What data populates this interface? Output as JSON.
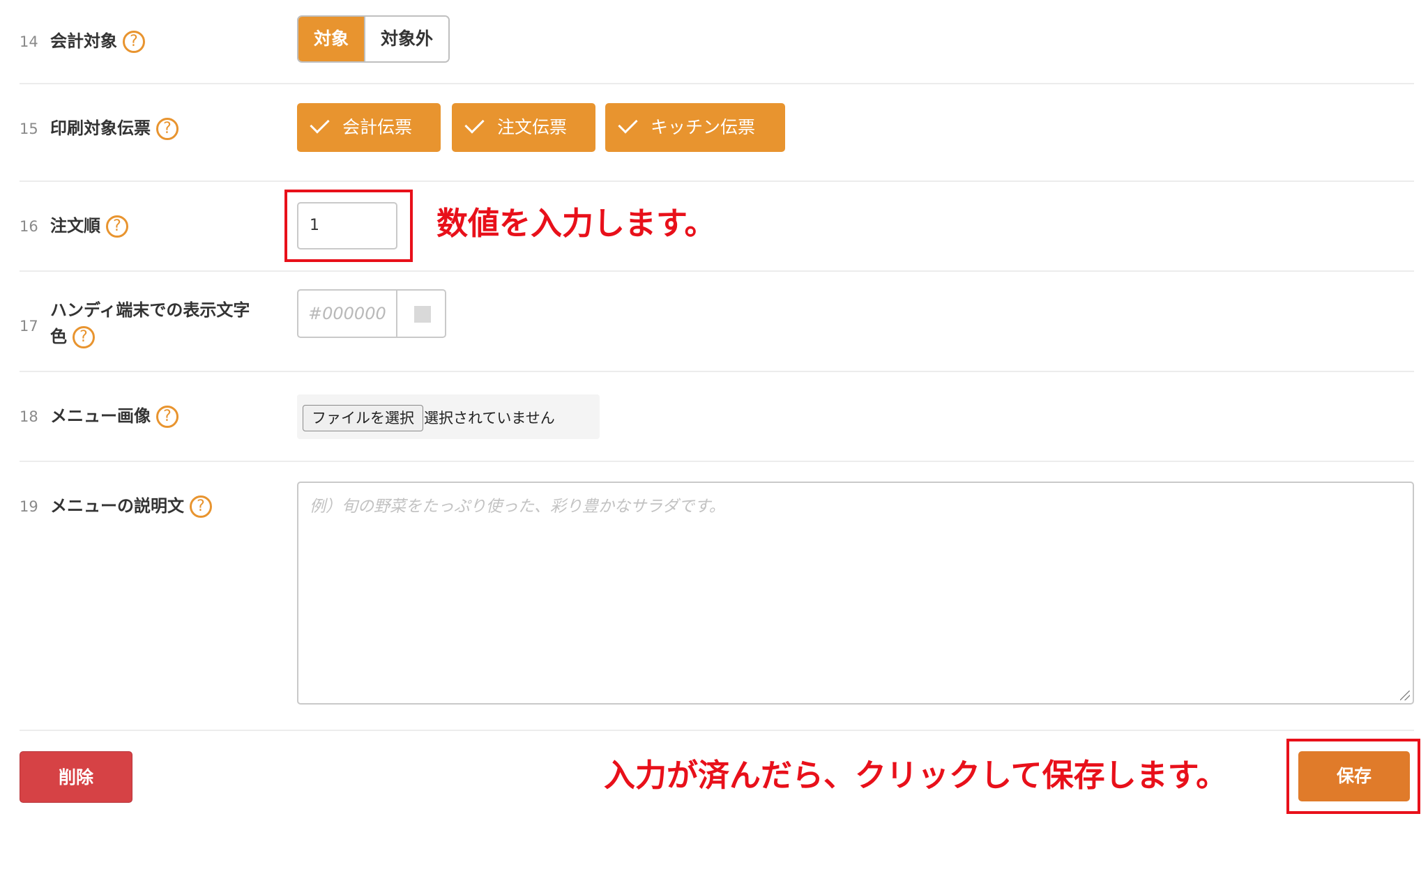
{
  "rows": [
    {
      "num": "14",
      "label": "会計対象",
      "options": [
        "対象",
        "対象外"
      ]
    },
    {
      "num": "15",
      "label": "印刷対象伝票",
      "checks": [
        "会計伝票",
        "注文伝票",
        "キッチン伝票"
      ]
    },
    {
      "num": "16",
      "label": "注文順",
      "value": "1",
      "note": "数値を入力します。"
    },
    {
      "num": "17",
      "label_line1": "ハンディ端末での表示文字",
      "label_line2": "色",
      "placeholder": "#000000"
    },
    {
      "num": "18",
      "label": "メニュー画像",
      "file_button": "ファイルを選択",
      "file_status": "選択されていません"
    },
    {
      "num": "19",
      "label": "メニューの説明文",
      "placeholder": "例）旬の野菜をたっぷり使った、彩り豊かなサラダです。"
    }
  ],
  "help_icon": "?",
  "footer": {
    "delete_label": "削除",
    "save_label": "保存",
    "note": "入力が済んだら、クリックして保存します。"
  },
  "colors": {
    "accent": "#e8942f",
    "danger": "#d64245",
    "annotation": "#e8101a",
    "save": "#e07b2a"
  }
}
